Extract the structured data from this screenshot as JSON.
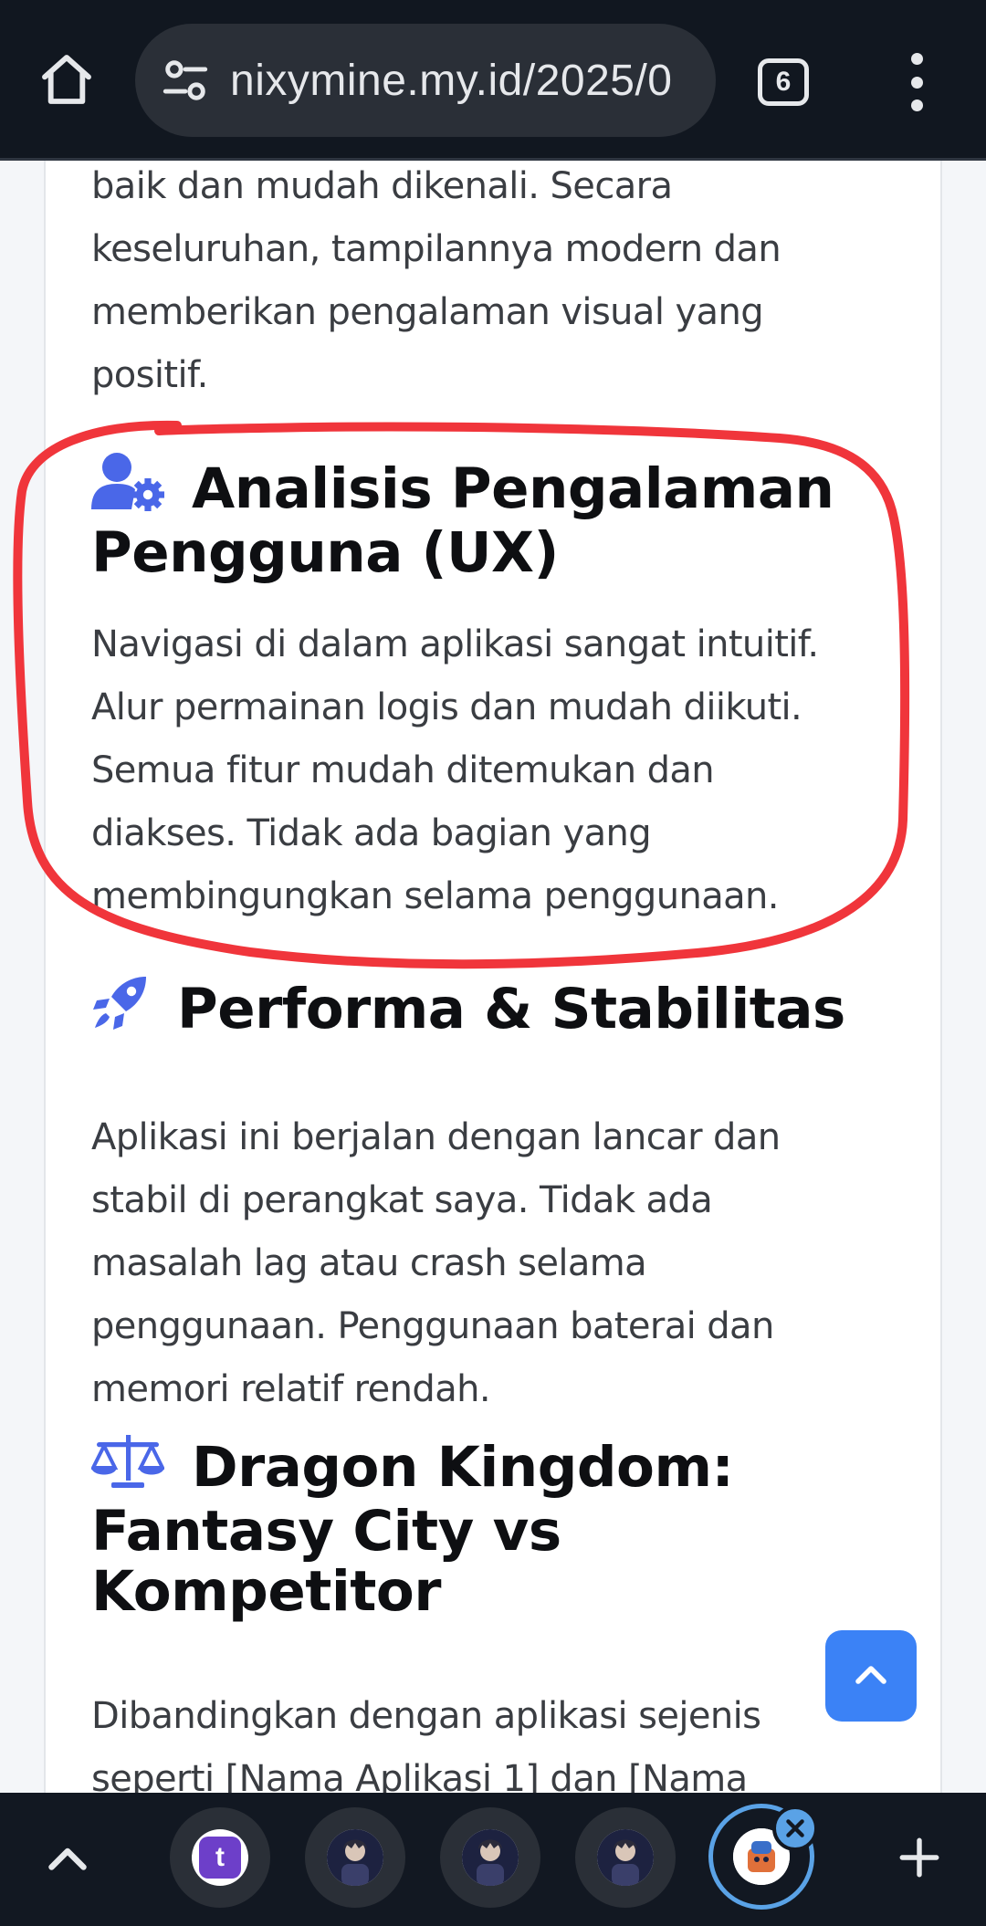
{
  "browser": {
    "url": "nixymine.my.id/2025/0",
    "tab_count": "6"
  },
  "article": {
    "intro_lines": [
      "baik dan mudah dikenali. Secara",
      "keseluruhan, tampilannya modern dan",
      "memberikan pengalaman visual yang",
      "positif."
    ],
    "sections": [
      {
        "icon": "user-gear-icon",
        "title_lines": [
          "Analisis Pengalaman",
          "Pengguna (UX)"
        ],
        "body_lines": [
          "Navigasi di dalam aplikasi sangat intuitif.",
          "Alur permainan logis dan mudah diikuti.",
          "Semua fitur mudah ditemukan dan",
          "diakses. Tidak ada bagian yang",
          "membingungkan selama penggunaan."
        ]
      },
      {
        "icon": "rocket-icon",
        "title_lines": [
          "Performa & Stabilitas"
        ],
        "body_lines": [
          "Aplikasi ini berjalan dengan lancar dan",
          "stabil di perangkat saya. Tidak ada",
          "masalah lag atau crash selama",
          "penggunaan. Penggunaan baterai dan",
          "memori relatif rendah."
        ]
      },
      {
        "icon": "scale-balance-icon",
        "title_lines": [
          "Dragon Kingdom:",
          "Fantasy City vs",
          "Kompetitor"
        ],
        "body_lines": [
          "Dibandingkan dengan aplikasi sejenis",
          "seperti [Nama Aplikasi 1] dan [Nama"
        ]
      }
    ]
  },
  "colors": {
    "accent_icon": "#4a67e8",
    "highlight_stroke": "#f0353b",
    "scroll_button": "#3b82f6",
    "active_tab_ring": "#5aa2e6"
  },
  "bottom_tabs": {
    "favicons": [
      "t",
      "game-avatar-icon",
      "game-avatar-icon",
      "game-avatar-icon",
      "game-app-icon"
    ]
  }
}
